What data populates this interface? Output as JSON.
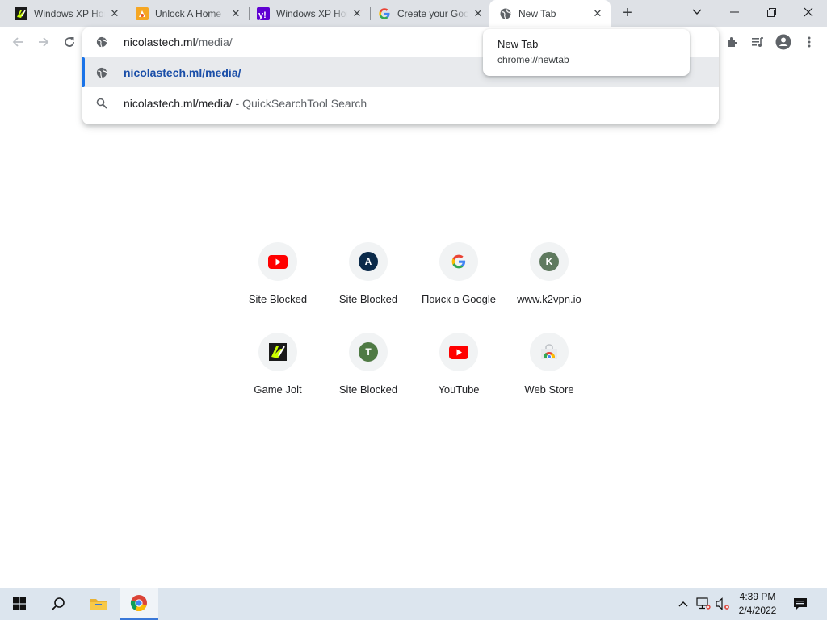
{
  "tabs": [
    {
      "title": "Windows XP Home",
      "favicon": "gamejolt-icon"
    },
    {
      "title": "Unlock A Home",
      "favicon": "unlock-icon"
    },
    {
      "title": "Windows XP Home",
      "favicon": "yahoo-icon"
    },
    {
      "title": "Create your Google",
      "favicon": "google-icon"
    },
    {
      "title": "New Tab",
      "favicon": "globe-icon",
      "active": true
    }
  ],
  "omnibox": {
    "host": "nicolastech.ml",
    "path": "/media/",
    "suggestions": [
      {
        "text": "nicolastech.ml/media/",
        "icon": "globe-icon",
        "selected": true
      },
      {
        "text": "nicolastech.ml/media/",
        "suffix": " - QuickSearchTool Search",
        "icon": "search-icon"
      }
    ]
  },
  "hovercard": {
    "title": "New Tab",
    "url": "chrome://newtab"
  },
  "shortcuts": [
    {
      "label": "Site Blocked",
      "icon": "youtube-icon"
    },
    {
      "label": "Site Blocked",
      "icon": "letter-a-icon",
      "letter": "A",
      "color": "#0b2a4a"
    },
    {
      "label": "Поиск в Google",
      "icon": "google-icon"
    },
    {
      "label": "www.k2vpn.io",
      "icon": "letter-k-icon",
      "letter": "K",
      "color": "#5f7a5f"
    },
    {
      "label": "Game Jolt",
      "icon": "gamejolt-icon"
    },
    {
      "label": "Site Blocked",
      "icon": "letter-t-icon",
      "letter": "T",
      "color": "#4f7a44"
    },
    {
      "label": "YouTube",
      "icon": "youtube-icon"
    },
    {
      "label": "Web Store",
      "icon": "webstore-icon"
    }
  ],
  "taskbar": {
    "time": "4:39 PM",
    "date": "2/4/2022"
  },
  "colors": {
    "accent": "#1a73e8",
    "tabstrip": "#dee1e6",
    "taskbar": "#dce5ee"
  }
}
